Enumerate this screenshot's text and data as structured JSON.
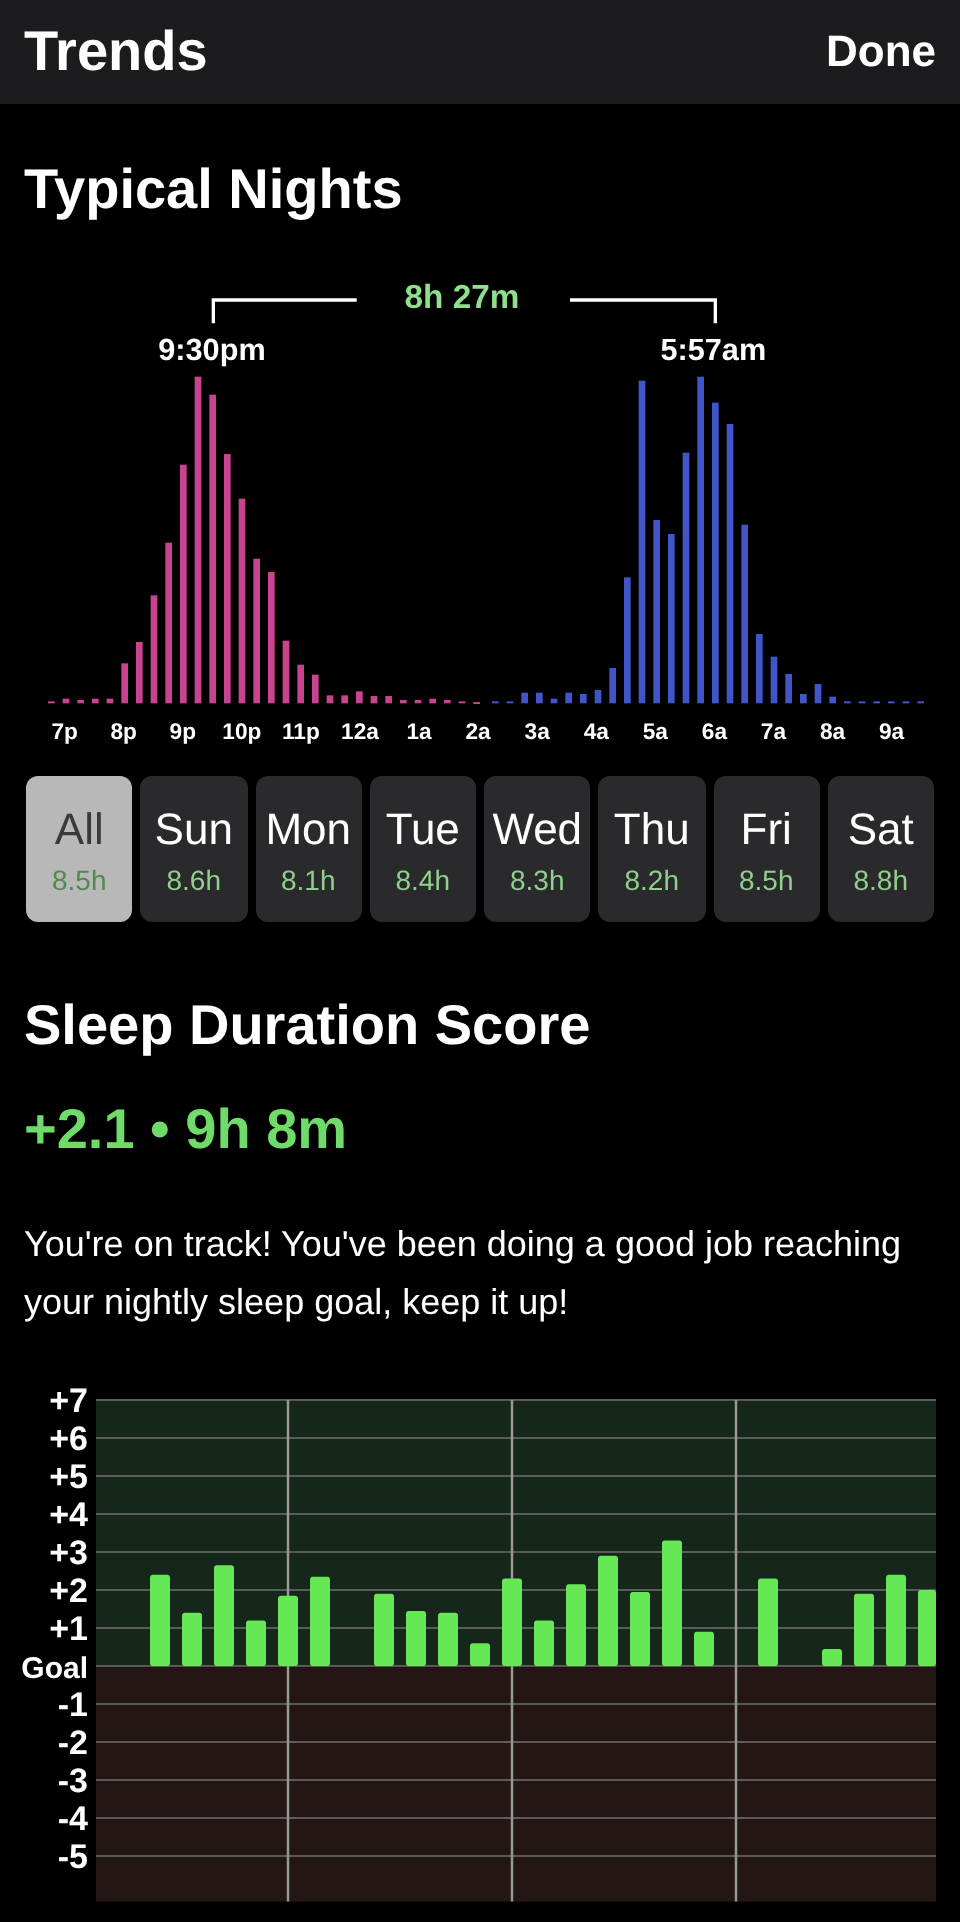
{
  "header": {
    "title": "Trends",
    "done_button": "Done"
  },
  "typical_nights": {
    "title": "Typical Nights",
    "duration": "8h 27m",
    "bedtime": "9:30pm",
    "waketime": "5:57am",
    "hour_labels": [
      "7p",
      "8p",
      "9p",
      "10p",
      "11p",
      "12a",
      "1a",
      "2a",
      "3a",
      "4a",
      "5a",
      "6a",
      "7a",
      "8a",
      "9a"
    ]
  },
  "days": [
    {
      "label": "All",
      "hours": "8.5h",
      "selected": true
    },
    {
      "label": "Sun",
      "hours": "8.6h",
      "selected": false
    },
    {
      "label": "Mon",
      "hours": "8.1h",
      "selected": false
    },
    {
      "label": "Tue",
      "hours": "8.4h",
      "selected": false
    },
    {
      "label": "Wed",
      "hours": "8.3h",
      "selected": false
    },
    {
      "label": "Thu",
      "hours": "8.2h",
      "selected": false
    },
    {
      "label": "Fri",
      "hours": "8.5h",
      "selected": false
    },
    {
      "label": "Sat",
      "hours": "8.8h",
      "selected": false
    }
  ],
  "score": {
    "title": "Sleep Duration Score",
    "value": "+2.1 • 9h 8m",
    "message": "You're on track! You've been doing a good job reaching your nightly sleep goal, keep it up!",
    "chart_data": {
      "type": "bar",
      "grid": true,
      "ylim": [
        -6.2,
        7
      ],
      "yticks": [
        {
          "value": 7,
          "label": "+7"
        },
        {
          "value": 6,
          "label": "+6"
        },
        {
          "value": 5,
          "label": "+5"
        },
        {
          "value": 4,
          "label": "+4"
        },
        {
          "value": 3,
          "label": "+3"
        },
        {
          "value": 2,
          "label": "+2"
        },
        {
          "value": 1,
          "label": "+1"
        },
        {
          "value": 0,
          "label": "Goal"
        },
        {
          "value": -1,
          "label": "-1"
        },
        {
          "value": -2,
          "label": "-2"
        },
        {
          "value": -3,
          "label": "-3"
        },
        {
          "value": -4,
          "label": "-4"
        },
        {
          "value": -5,
          "label": "-5"
        }
      ],
      "values": [
        null,
        null,
        2.4,
        1.4,
        2.65,
        1.2,
        1.85,
        2.35,
        null,
        1.9,
        1.45,
        1.4,
        0.6,
        2.3,
        1.2,
        2.15,
        2.9,
        1.95,
        3.3,
        0.9,
        null,
        2.3,
        null,
        0.45,
        1.9,
        2.4,
        2.0
      ]
    }
  }
}
